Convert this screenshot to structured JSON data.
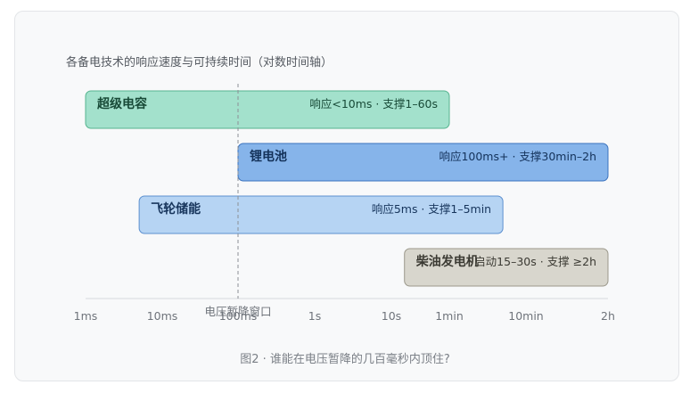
{
  "chart_data": {
    "type": "bar",
    "orientation": "horizontal",
    "title": "各备电技术的响应速度与可持续时间（对数时间轴）",
    "caption": "图2 · 谁能在电压暂降的几百毫秒内顶住?",
    "x_scale": "log",
    "x_unit": "seconds",
    "x_ticks": [
      {
        "label": "1ms",
        "value": 0.001
      },
      {
        "label": "10ms",
        "value": 0.01
      },
      {
        "label": "100ms",
        "value": 0.1
      },
      {
        "label": "1s",
        "value": 1
      },
      {
        "label": "10s",
        "value": 10
      },
      {
        "label": "1min",
        "value": 60
      },
      {
        "label": "10min",
        "value": 600
      },
      {
        "label": "2h",
        "value": 7200
      }
    ],
    "xlim": [
      0.001,
      7200
    ],
    "reference_line": {
      "label": "电压暂降窗口",
      "value": 0.1
    },
    "bars": [
      {
        "name": "超级电容",
        "note": "响应<10ms · 支撑1–60s",
        "start": 0.001,
        "end": 60,
        "fill": "#a3e1cc",
        "stroke": "#56b48f",
        "text_color": "#184a37"
      },
      {
        "name": "锂电池",
        "note": "响应100ms+ · 支撑30min–2h",
        "start": 0.1,
        "end": 7200,
        "fill": "#86b4ea",
        "stroke": "#3a72be",
        "text_color": "#14325a"
      },
      {
        "name": "飞轮储能",
        "note": "响应5ms · 支撑1–5min",
        "start": 0.005,
        "end": 300,
        "fill": "#b6d4f3",
        "stroke": "#5b8fcf",
        "text_color": "#17355c"
      },
      {
        "name": "柴油发电机",
        "note": "启动15–30s · 支撑 ≥2h",
        "start": 15,
        "end": 7200,
        "fill": "#d8d6cd",
        "stroke": "#9b988b",
        "text_color": "#3b3a33"
      }
    ]
  }
}
